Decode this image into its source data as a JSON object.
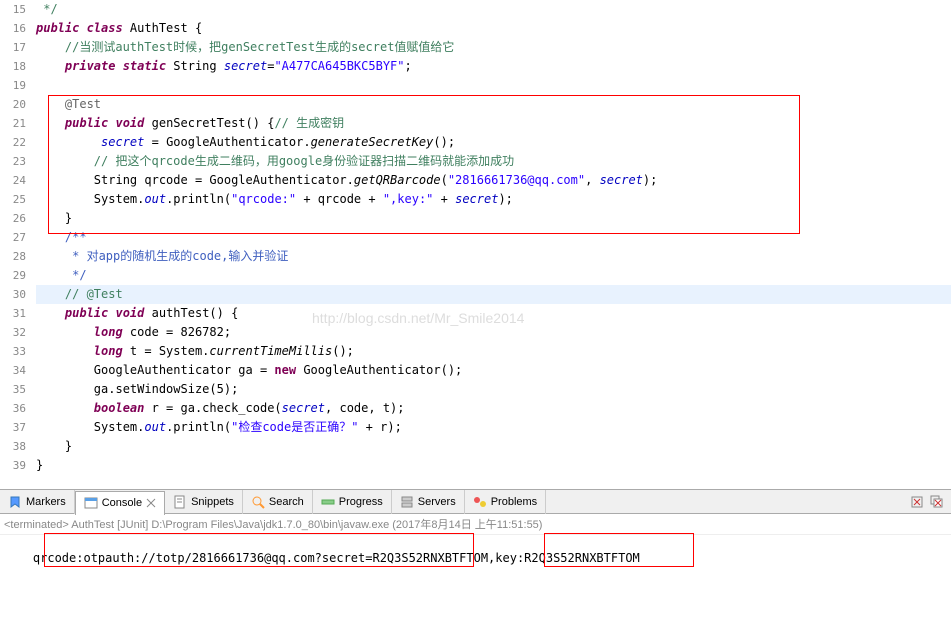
{
  "editor": {
    "first_line": 15,
    "highlighted_line": 30,
    "lines": [
      {
        "n": 15,
        "seg": [
          {
            "c": "cmt",
            "t": " */"
          }
        ]
      },
      {
        "n": 16,
        "seg": [
          {
            "c": "kw",
            "t": "public class"
          },
          {
            "t": " AuthTest {"
          }
        ]
      },
      {
        "n": 17,
        "seg": [
          {
            "t": "    "
          },
          {
            "c": "cmt",
            "t": "//当测试authTest时候，把genSecretTest生成的secret值赋值给它"
          }
        ]
      },
      {
        "n": 18,
        "seg": [
          {
            "t": "    "
          },
          {
            "c": "kw",
            "t": "private static"
          },
          {
            "t": " String "
          },
          {
            "c": "fld",
            "t": "secret"
          },
          {
            "t": "="
          },
          {
            "c": "str",
            "t": "\"A477CA645BKC5BYF\""
          },
          {
            "t": ";"
          }
        ]
      },
      {
        "n": 19,
        "seg": [
          {
            "t": ""
          }
        ]
      },
      {
        "n": 20,
        "seg": [
          {
            "t": "    "
          },
          {
            "c": "ann",
            "t": "@Test"
          }
        ]
      },
      {
        "n": 21,
        "seg": [
          {
            "t": "    "
          },
          {
            "c": "kw",
            "t": "public void"
          },
          {
            "t": " genSecretTest() {"
          },
          {
            "c": "cmt",
            "t": "// 生成密钥"
          }
        ]
      },
      {
        "n": 22,
        "seg": [
          {
            "t": "         "
          },
          {
            "c": "fld",
            "t": "secret"
          },
          {
            "t": " = GoogleAuthenticator."
          },
          {
            "c": "mi",
            "t": "generateSecretKey"
          },
          {
            "t": "();"
          }
        ]
      },
      {
        "n": 23,
        "seg": [
          {
            "t": "        "
          },
          {
            "c": "cmt",
            "t": "// 把这个qrcode生成二维码，用google身份验证器扫描二维码就能添加成功"
          }
        ]
      },
      {
        "n": 24,
        "seg": [
          {
            "t": "        String qrcode = GoogleAuthenticator."
          },
          {
            "c": "mi",
            "t": "getQRBarcode"
          },
          {
            "t": "("
          },
          {
            "c": "str",
            "t": "\"2816661736@qq.com\""
          },
          {
            "t": ", "
          },
          {
            "c": "fld",
            "t": "secret"
          },
          {
            "t": ");"
          }
        ]
      },
      {
        "n": 25,
        "seg": [
          {
            "t": "        System."
          },
          {
            "c": "fld",
            "t": "out"
          },
          {
            "t": ".println("
          },
          {
            "c": "str",
            "t": "\"qrcode:\""
          },
          {
            "t": " + qrcode + "
          },
          {
            "c": "str",
            "t": "\",key:\""
          },
          {
            "t": " + "
          },
          {
            "c": "fld",
            "t": "secret"
          },
          {
            "t": ");"
          }
        ]
      },
      {
        "n": 26,
        "seg": [
          {
            "t": "    }"
          }
        ]
      },
      {
        "n": 27,
        "seg": [
          {
            "t": "    "
          },
          {
            "c": "doc",
            "t": "/**"
          }
        ]
      },
      {
        "n": 28,
        "seg": [
          {
            "t": "     "
          },
          {
            "c": "doc",
            "t": "* 对app的随机生成的code,输入并验证"
          }
        ]
      },
      {
        "n": 29,
        "seg": [
          {
            "t": "     "
          },
          {
            "c": "doc",
            "t": "*/"
          }
        ]
      },
      {
        "n": 30,
        "seg": [
          {
            "t": "    "
          },
          {
            "c": "cmt",
            "t": "// @Test"
          }
        ]
      },
      {
        "n": 31,
        "seg": [
          {
            "t": "    "
          },
          {
            "c": "kw",
            "t": "public void"
          },
          {
            "t": " authTest() {"
          }
        ]
      },
      {
        "n": 32,
        "seg": [
          {
            "t": "        "
          },
          {
            "c": "kw",
            "t": "long"
          },
          {
            "t": " code = 826782;"
          }
        ]
      },
      {
        "n": 33,
        "seg": [
          {
            "t": "        "
          },
          {
            "c": "kw",
            "t": "long"
          },
          {
            "t": " t = System."
          },
          {
            "c": "mi",
            "t": "currentTimeMillis"
          },
          {
            "t": "();"
          }
        ]
      },
      {
        "n": 34,
        "seg": [
          {
            "t": "        GoogleAuthenticator ga = "
          },
          {
            "c": "kw2",
            "t": "new"
          },
          {
            "t": " GoogleAuthenticator();"
          }
        ]
      },
      {
        "n": 35,
        "seg": [
          {
            "t": "        ga.setWindowSize(5);"
          }
        ]
      },
      {
        "n": 36,
        "seg": [
          {
            "t": "        "
          },
          {
            "c": "kw",
            "t": "boolean"
          },
          {
            "t": " r = ga.check_code("
          },
          {
            "c": "fld",
            "t": "secret"
          },
          {
            "t": ", code, t);"
          }
        ]
      },
      {
        "n": 37,
        "seg": [
          {
            "t": "        System."
          },
          {
            "c": "fld",
            "t": "out"
          },
          {
            "t": ".println("
          },
          {
            "c": "str",
            "t": "\"检查code是否正确？\""
          },
          {
            "t": " + r);"
          }
        ]
      },
      {
        "n": 38,
        "seg": [
          {
            "t": "    }"
          }
        ]
      },
      {
        "n": 39,
        "seg": [
          {
            "t": "}"
          }
        ]
      }
    ],
    "watermark": "http://blog.csdn.net/Mr_Smile2014"
  },
  "tabs": [
    {
      "label": "Markers",
      "icon": "markers"
    },
    {
      "label": "Console",
      "icon": "console",
      "active": true,
      "closable": true
    },
    {
      "label": "Snippets",
      "icon": "snippets"
    },
    {
      "label": "Search",
      "icon": "search"
    },
    {
      "label": "Progress",
      "icon": "progress"
    },
    {
      "label": "Servers",
      "icon": "servers"
    },
    {
      "label": "Problems",
      "icon": "problems"
    }
  ],
  "console": {
    "status": "<terminated> AuthTest [JUnit] D:\\Program Files\\Java\\jdk1.7.0_80\\bin\\javaw.exe (2017年8月14日 上午11:51:55)",
    "output": "qrcode:otpauth://totp/2816661736@qq.com?secret=R2Q3S52RNXBTFTOM,key:R2Q3S52RNXBTFTOM"
  }
}
